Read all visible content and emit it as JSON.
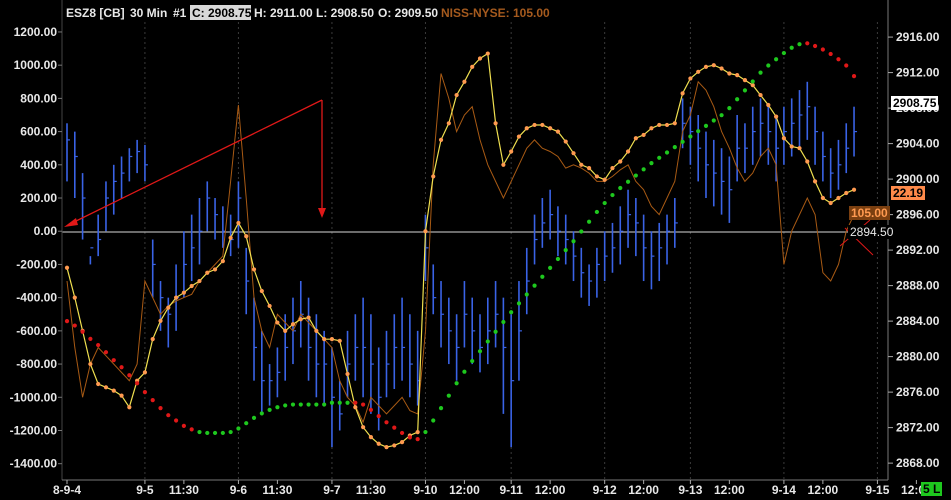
{
  "header": {
    "symbol": "ESZ8 [CB]",
    "interval": "30 Min",
    "num": "#1",
    "close": "C: 2908.75",
    "high": "H: 2911.00",
    "low": "L: 2908.50",
    "open": "O: 2909.50",
    "indicator": "NISS-NYSE: 105.00"
  },
  "colors": {
    "price_bars": "#3a63e6",
    "yellow_line": "#f0e050",
    "orange_dots": "#ff9a50",
    "thin_line": "#a85a14",
    "psar_up": "#1ec81e",
    "psar_down": "#e01818",
    "arrows": "#e01818",
    "last_price_badge": "#ffffff",
    "niss_badge": "#7a3f10",
    "value_badge": "#ff8a4a"
  },
  "badges": {
    "last_price": "2908.75",
    "smoothed_value": "22.19",
    "niss_value": "105.00",
    "zero_price": "2894.50",
    "corner": "5 L"
  },
  "chart_data": {
    "type": "bar",
    "left_axis": {
      "ticks": [
        "1200.00",
        "1000.00",
        "800.00",
        "600.00",
        "400.00",
        "200.00",
        "0.00",
        "-200.00",
        "-400.00",
        "-600.00",
        "-800.00",
        "-1000.00",
        "-1200.00",
        "-1400.00"
      ],
      "range": [
        -1450,
        1260
      ]
    },
    "right_axis": {
      "ticks": [
        "2916.00",
        "2912.00",
        "2908.00",
        "2904.00",
        "2900.00",
        "2896.00",
        "2892.00",
        "2888.00",
        "2884.00",
        "2880.00",
        "2876.00",
        "2872.00",
        "2868.00"
      ],
      "range": [
        2867.0,
        2917.7
      ]
    },
    "x_labels": [
      "8-9-4",
      "9-5",
      "11:30",
      "9-6",
      "11:30",
      "9-7",
      "11:30",
      "9-10",
      "12:00",
      "9-11",
      "12:00",
      "9-12",
      "12:00",
      "9-13",
      "12:00",
      "9-14",
      "12:00",
      "9-15",
      "12:00"
    ],
    "x_label_index": [
      0,
      10,
      15,
      22,
      27,
      34,
      39,
      46,
      51,
      57,
      62,
      69,
      74,
      80,
      85,
      92,
      97,
      104,
      109
    ],
    "session_breaks": [
      10,
      22,
      34,
      46,
      57,
      69,
      80,
      92,
      104
    ],
    "bars_count": 106,
    "niss_bars": {
      "name": "NISS-NYSE",
      "x": [
        0,
        1,
        2,
        3,
        4,
        5,
        6,
        7,
        8,
        9,
        10,
        11,
        12,
        13,
        14,
        15,
        16,
        17,
        18,
        19,
        20,
        21,
        22,
        23,
        24,
        25,
        26,
        27,
        28,
        29,
        30,
        31,
        32,
        33,
        34,
        35,
        36,
        37,
        38,
        39,
        40,
        41,
        42,
        43,
        44,
        45,
        46,
        47,
        48,
        49,
        50,
        51,
        52,
        53,
        54,
        55,
        56,
        57,
        58,
        59,
        60,
        61,
        62,
        63,
        64,
        65,
        66,
        67,
        68,
        69,
        70,
        71,
        72,
        73,
        74,
        75,
        76,
        77,
        78,
        79,
        80,
        81,
        82,
        83,
        84,
        85,
        86,
        87,
        88,
        89,
        90,
        91,
        92,
        93,
        94,
        95,
        96,
        97,
        98,
        99,
        100,
        101
      ],
      "high": [
        650,
        600,
        350,
        -150,
        100,
        300,
        400,
        450,
        500,
        550,
        520,
        -50,
        -300,
        -400,
        -200,
        0,
        100,
        200,
        300,
        200,
        150,
        100,
        300,
        -100,
        -400,
        -600,
        -800,
        -700,
        -500,
        -400,
        -300,
        -400,
        -500,
        -600,
        -700,
        -900,
        -600,
        -500,
        -400,
        -500,
        -700,
        -600,
        -500,
        -400,
        -500,
        -600,
        100,
        -200,
        -300,
        -400,
        -500,
        -300,
        -400,
        -500,
        -400,
        -300,
        -400,
        -500,
        -300,
        -100,
        100,
        200,
        250,
        150,
        100,
        0,
        -100,
        -200,
        -100,
        0,
        50,
        150,
        250,
        200,
        100,
        0,
        50,
        100,
        200,
        800,
        750,
        700,
        600,
        550,
        500,
        450,
        700,
        650,
        750,
        800,
        750,
        700,
        750,
        800,
        850,
        900,
        750,
        600,
        500,
        550,
        650,
        750,
        800
      ],
      "low": [
        300,
        200,
        -50,
        -200,
        -150,
        0,
        100,
        200,
        300,
        350,
        300,
        -400,
        -600,
        -700,
        -600,
        -400,
        -300,
        -200,
        0,
        -50,
        -100,
        -150,
        -100,
        -500,
        -900,
        -1100,
        -1050,
        -1000,
        -900,
        -800,
        -700,
        -900,
        -1000,
        -1050,
        -1300,
        -1200,
        -1000,
        -900,
        -1000,
        -1100,
        -1200,
        -1000,
        -950,
        -900,
        -1000,
        -1050,
        -300,
        -500,
        -700,
        -800,
        -900,
        -700,
        -800,
        -850,
        -800,
        -700,
        -1100,
        -1300,
        -900,
        -500,
        -200,
        -100,
        -50,
        -150,
        -200,
        -300,
        -400,
        -450,
        -400,
        -300,
        -250,
        -200,
        -100,
        -150,
        -300,
        -350,
        -300,
        -200,
        -100,
        500,
        400,
        300,
        200,
        150,
        100,
        50,
        300,
        350,
        400,
        450,
        400,
        300,
        400,
        450,
        500,
        550,
        400,
        300,
        200,
        250,
        350,
        450,
        500
      ],
      "close": [
        550,
        450,
        200,
        -100,
        -50,
        200,
        300,
        350,
        450,
        480,
        400,
        -200,
        -400,
        -500,
        -400,
        -200,
        -100,
        0,
        200,
        100,
        0,
        -50,
        200,
        -300,
        -700,
        -900,
        -900,
        -850,
        -700,
        -600,
        -500,
        -700,
        -800,
        -800,
        -1000,
        -1100,
        -800,
        -700,
        -700,
        -800,
        -1000,
        -800,
        -700,
        -700,
        -800,
        -900,
        -100,
        -400,
        -500,
        -600,
        -700,
        -500,
        -600,
        -700,
        -600,
        -500,
        -700,
        -900,
        -600,
        -300,
        -50,
        50,
        100,
        0,
        -50,
        -150,
        -250,
        -300,
        -200,
        -150,
        -100,
        0,
        100,
        50,
        -100,
        -150,
        -100,
        0,
        50,
        650,
        600,
        500,
        400,
        350,
        300,
        250,
        500,
        500,
        600,
        650,
        600,
        500,
        600,
        650,
        700,
        750,
        600,
        450,
        350,
        400,
        500,
        600,
        650
      ]
    },
    "yellow_line": {
      "name": "NISS-NYSE average",
      "values": [
        -220,
        -400,
        -600,
        -800,
        -920,
        -940,
        -960,
        -990,
        -1060,
        -900,
        -850,
        -650,
        -540,
        -460,
        -400,
        -370,
        -330,
        -300,
        -250,
        -230,
        -180,
        -40,
        50,
        -30,
        -230,
        -360,
        -450,
        -550,
        -600,
        -560,
        -530,
        -520,
        -600,
        -650,
        -650,
        -660,
        -860,
        -1060,
        -1180,
        -1240,
        -1280,
        -1300,
        -1290,
        -1270,
        -1230,
        -1210,
        0,
        330,
        550,
        650,
        820,
        900,
        990,
        1040,
        1070,
        650,
        400,
        480,
        570,
        620,
        640,
        640,
        620,
        600,
        540,
        470,
        400,
        380,
        330,
        310,
        380,
        420,
        480,
        560,
        580,
        620,
        640,
        640,
        650,
        830,
        920,
        960,
        990,
        1000,
        980,
        950,
        940,
        910,
        880,
        820,
        760,
        690,
        560,
        510,
        500,
        420,
        300,
        200,
        170,
        200,
        230,
        250
      ]
    },
    "orange_dots": {
      "name": "NISS-NYSE average dots",
      "values": [
        -220,
        -400,
        -600,
        -800,
        -920,
        -940,
        -960,
        -990,
        -1060,
        -900,
        -850,
        -650,
        -540,
        -460,
        -400,
        -370,
        -330,
        -300,
        -250,
        -230,
        -180,
        -40,
        50,
        -30,
        -230,
        -360,
        -450,
        -550,
        -600,
        -560,
        -530,
        -520,
        -600,
        -650,
        -650,
        -660,
        -860,
        -1060,
        -1180,
        -1240,
        -1280,
        -1300,
        -1290,
        -1270,
        -1230,
        -1210,
        0,
        330,
        550,
        650,
        820,
        900,
        990,
        1040,
        1070,
        650,
        400,
        480,
        570,
        620,
        640,
        640,
        620,
        600,
        540,
        470,
        400,
        380,
        330,
        310,
        380,
        420,
        480,
        560,
        580,
        620,
        640,
        640,
        650,
        830,
        920,
        960,
        990,
        1000,
        980,
        950,
        940,
        910,
        880,
        820,
        760,
        690,
        560,
        510,
        500,
        420,
        300,
        200,
        170,
        200,
        230,
        250
      ]
    },
    "thin_line": {
      "name": "NISS-NYSE raw",
      "values": [
        -300,
        -700,
        -1000,
        -800,
        -700,
        -750,
        -800,
        -850,
        -900,
        -800,
        -300,
        -400,
        -500,
        -450,
        -420,
        -400,
        -380,
        -300,
        -250,
        -200,
        -150,
        300,
        760,
        200,
        -400,
        -600,
        -700,
        -500,
        -550,
        -600,
        -500,
        -550,
        -600,
        -650,
        -700,
        -900,
        -1000,
        -1050,
        -1150,
        -1000,
        -1050,
        -1100,
        -1050,
        -1000,
        -1080,
        -1100,
        -600,
        400,
        950,
        800,
        600,
        700,
        750,
        550,
        400,
        300,
        200,
        300,
        400,
        500,
        550,
        500,
        480,
        450,
        380,
        400,
        380,
        350,
        300,
        300,
        330,
        370,
        400,
        300,
        250,
        150,
        100,
        200,
        300,
        600,
        700,
        900,
        850,
        750,
        600,
        500,
        380,
        300,
        350,
        450,
        500,
        400,
        -200,
        0,
        100,
        200,
        100,
        -250,
        -300,
        -200,
        0,
        100,
        130
      ]
    },
    "psar": {
      "name": "PSAR (right axis)",
      "values": [
        2884.0,
        2883.5,
        2882.8,
        2882.0,
        2881.3,
        2880.5,
        2879.6,
        2878.8,
        2877.9,
        2877.0,
        2876.0,
        2875.1,
        2874.2,
        2873.4,
        2872.8,
        2872.2,
        2871.8,
        2871.5,
        2871.4,
        2871.4,
        2871.4,
        2871.5,
        2871.9,
        2872.5,
        2873.1,
        2873.6,
        2874.0,
        2874.3,
        2874.5,
        2874.6,
        2874.6,
        2874.6,
        2874.6,
        2874.6,
        2874.8,
        2874.8,
        2874.8,
        2874.8,
        2874.6,
        2874.0,
        2873.3,
        2872.6,
        2872.0,
        2871.4,
        2870.9,
        2870.7,
        2871.5,
        2872.8,
        2874.2,
        2875.6,
        2877.0,
        2878.3,
        2879.5,
        2880.6,
        2881.7,
        2882.8,
        2883.9,
        2885.0,
        2886.0,
        2887.0,
        2888.0,
        2889.0,
        2890.0,
        2891.0,
        2892.0,
        2893.0,
        2894.1,
        2895.2,
        2896.3,
        2897.3,
        2898.2,
        2899.0,
        2899.7,
        2900.4,
        2901.1,
        2901.8,
        2902.4,
        2903.0,
        2903.6,
        2904.2,
        2904.8,
        2905.4,
        2906.0,
        2906.6,
        2907.2,
        2908.0,
        2909.0,
        2910.0,
        2911.0,
        2912.0,
        2912.8,
        2913.5,
        2914.2,
        2914.8,
        2915.2,
        2915.3,
        2915.0,
        2914.6,
        2914.1,
        2913.5,
        2912.8,
        2911.6
      ],
      "down_trend_index": [
        0,
        1,
        2,
        3,
        4,
        5,
        6,
        7,
        8,
        9,
        10,
        11,
        12,
        13,
        14,
        15,
        16,
        37,
        38,
        39,
        40,
        41,
        42,
        43,
        44,
        45,
        95,
        96,
        97,
        98,
        99,
        100,
        101
      ]
    }
  }
}
